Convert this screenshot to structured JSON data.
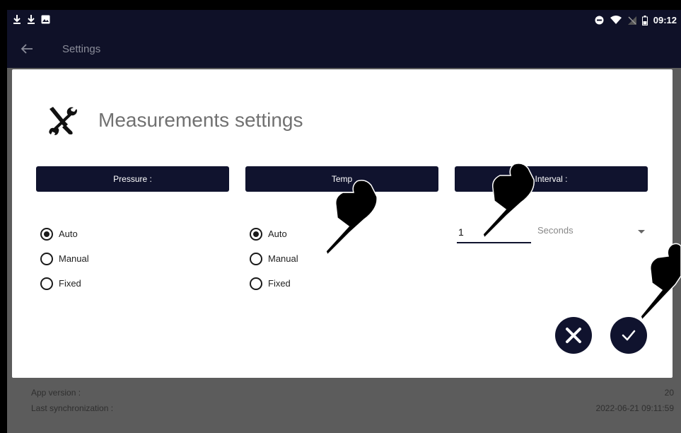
{
  "statusbar": {
    "time": "09:12"
  },
  "appbar": {
    "title": "Settings"
  },
  "background": {
    "app_version_label": "App version :",
    "app_version_value": "20",
    "last_sync_label": "Last synchronization :",
    "last_sync_value": "2022-06-21 09:11:59"
  },
  "dialog": {
    "title": "Measurements settings",
    "pressure": {
      "header": "Pressure :",
      "options": [
        {
          "label": "Auto",
          "selected": true
        },
        {
          "label": "Manual",
          "selected": false
        },
        {
          "label": "Fixed",
          "selected": false
        }
      ]
    },
    "temperature": {
      "header": "Temp",
      "options": [
        {
          "label": "Auto",
          "selected": true
        },
        {
          "label": "Manual",
          "selected": false
        },
        {
          "label": "Fixed",
          "selected": false
        }
      ]
    },
    "interval": {
      "header": "Interval :",
      "value": "1",
      "unit": "Seconds"
    }
  },
  "colors": {
    "navy": "#10132e",
    "statusbar": "#0f1128",
    "overlay": "#5c5c5c"
  }
}
